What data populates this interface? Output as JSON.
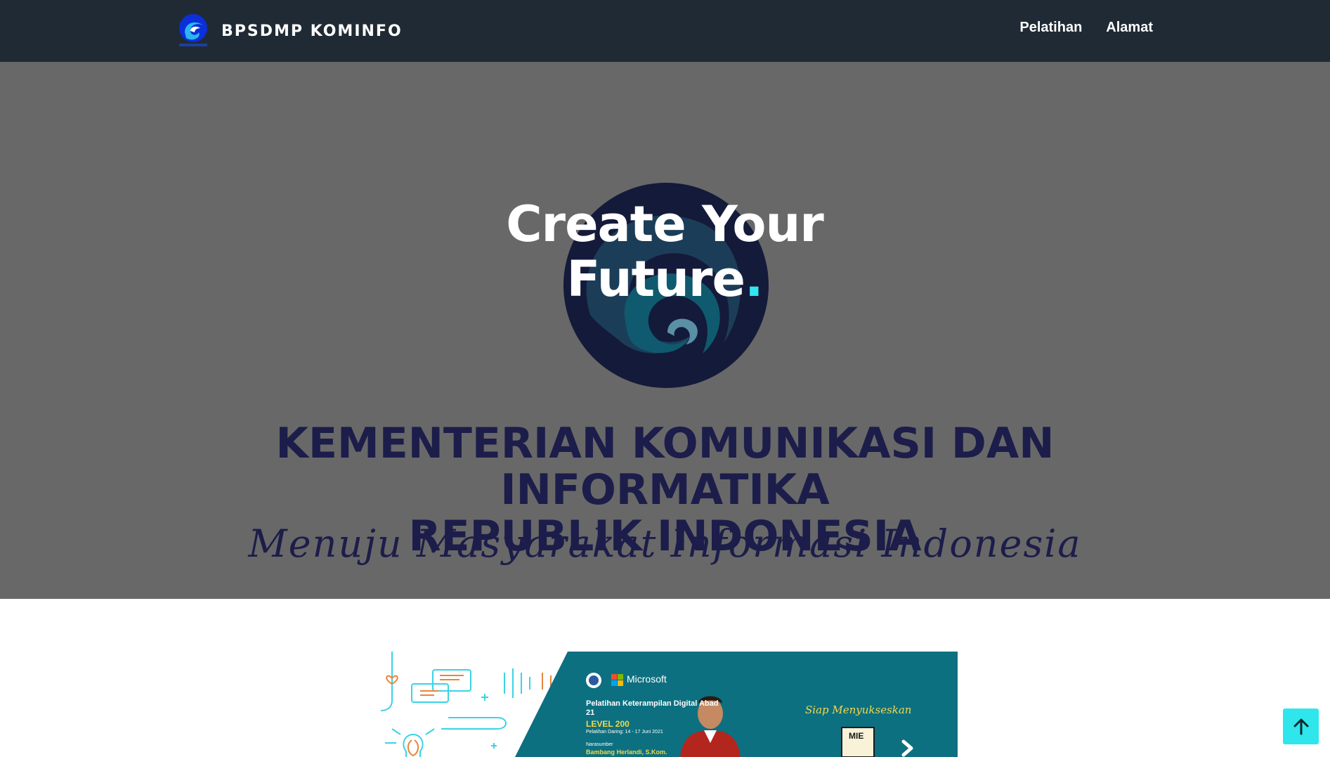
{
  "navbar": {
    "brand": "BPSDMP KOMINFO",
    "links": [
      "Pelatihan",
      "Alamat"
    ]
  },
  "hero": {
    "headline_line1": "Create Your",
    "headline_line2": "Future",
    "headline_dot": ".",
    "ministry_line1": "KEMENTERIAN KOMUNIKASI DAN INFORMATIKA",
    "ministry_line2": "REPUBLIK INDONESIA",
    "motto": "Menuju Masyarakat Informasi Indonesia"
  },
  "banner": {
    "partner_logo": "Microsoft",
    "course_title": "Pelatihan Keterampilan Digital Abad 21",
    "level": "LEVEL 200",
    "date": "Pelatihan Daring: 14 - 17 Juni 2021",
    "speaker_label": "Narasumber",
    "speaker_name": "Bambang Herlandi, S.Kom.",
    "tagline": "Siap Menyukseskan",
    "badge": "MIE"
  },
  "colors": {
    "navbar_bg": "#1f2a34",
    "hero_overlay": "#686868",
    "accent": "#33e5f0",
    "banner_teal": "#0d7080",
    "ministry_text": "#1c1d4a"
  },
  "icons": {
    "brand": "kominfo-logo-icon",
    "back_to_top": "arrow-up-icon",
    "banner_next": "chevron-right-icon"
  }
}
